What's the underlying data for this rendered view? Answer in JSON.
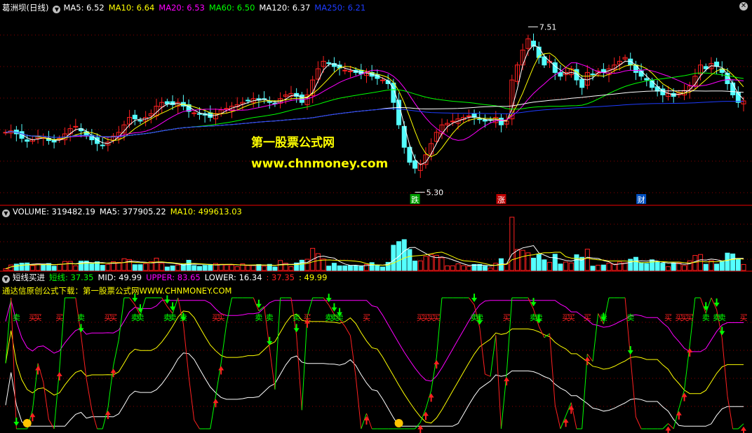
{
  "main_header": {
    "title": "葛洲坝(日线)",
    "ma5": "MA5: 6.52",
    "ma10": "MA10: 6.64",
    "ma20": "MA20: 6.53",
    "ma60": "MA60: 6.50",
    "ma120": "MA120: 6.37",
    "ma250": "MA250: 6.21"
  },
  "volume_header": {
    "volume": "VOLUME: 319482.19",
    "ma5": "MA5: 377905.22",
    "ma10": "MA10: 499613.03"
  },
  "indicator_header": {
    "name": "短线买进",
    "short": "短线: 37.35",
    "mid": "MID: 49.99",
    "upper": "UPPER: 83.65",
    "lower": "LOWER: 16.34",
    "extra1": ": 37.35",
    "extra2": ": 49.99"
  },
  "indicator_note": "通达信原创公式下载：第一股票公式网WWW.CHNMONEY.COM",
  "watermark": {
    "line1": "第一股票公式网",
    "line2": "www.chnmoney.com"
  },
  "colors": {
    "ma5": "#ffffff",
    "ma10": "#ffff00",
    "ma20": "#ff00ff",
    "ma60": "#00ff00",
    "ma120": "#ffffff",
    "ma250": "#1e3cff",
    "up": "#ff2020",
    "down": "#54ffff",
    "grid": "#8b0000"
  },
  "chart_data": [
    {
      "type": "candlestick",
      "title": "葛洲坝(日线)",
      "ylim": [
        5.2,
        7.7
      ],
      "annotations": [
        {
          "label": "7.51",
          "kind": "high"
        },
        {
          "label": "5.30",
          "kind": "low"
        }
      ],
      "event_tags": [
        "跌",
        "涨",
        "财"
      ],
      "series": [
        {
          "name": "MA5",
          "key": "ma5"
        },
        {
          "name": "MA10",
          "key": "ma10"
        },
        {
          "name": "MA20",
          "key": "ma20"
        },
        {
          "name": "MA60",
          "key": "ma60"
        },
        {
          "name": "MA120",
          "key": "ma120"
        },
        {
          "name": "MA250",
          "key": "ma250"
        }
      ],
      "closes": [
        6.1,
        6.12,
        6.08,
        6.02,
        5.98,
        6.0,
        6.05,
        6.03,
        5.99,
        5.97,
        6.02,
        6.08,
        6.15,
        6.18,
        6.12,
        6.05,
        6.0,
        5.95,
        5.93,
        5.97,
        6.05,
        6.1,
        6.2,
        6.3,
        6.28,
        6.25,
        6.3,
        6.35,
        6.45,
        6.5,
        6.48,
        6.47,
        6.5,
        6.45,
        6.38,
        6.36,
        6.34,
        6.33,
        6.3,
        6.35,
        6.4,
        6.42,
        6.45,
        6.47,
        6.5,
        6.52,
        6.55,
        6.53,
        6.54,
        6.5,
        6.48,
        6.55,
        6.6,
        6.62,
        6.58,
        6.5,
        6.6,
        6.8,
        6.95,
        7.05,
        7.02,
        6.98,
        6.96,
        6.93,
        6.92,
        6.9,
        6.88,
        6.9,
        6.85,
        6.82,
        6.8,
        6.75,
        6.5,
        6.2,
        5.9,
        5.7,
        5.62,
        5.68,
        5.8,
        5.95,
        6.1,
        6.2,
        6.22,
        6.25,
        6.28,
        6.3,
        6.32,
        6.3,
        6.27,
        6.25,
        6.26,
        6.3,
        6.2,
        6.25,
        6.8,
        7.0,
        7.2,
        7.35,
        7.25,
        7.1,
        7.0,
        7.05,
        6.9,
        6.85,
        6.9,
        6.95,
        6.8,
        6.7,
        6.9,
        6.88,
        6.92,
        6.9,
        6.95,
        7.0,
        7.05,
        7.1,
        7.0,
        6.9,
        6.85,
        6.8,
        6.7,
        6.65,
        6.6,
        6.62,
        6.58,
        6.63,
        6.66,
        6.72,
        6.85,
        7.0,
        6.95,
        7.02,
        6.98,
        6.9,
        6.75,
        6.6,
        6.5,
        6.52
      ],
      "volume": {
        "title": "VOLUME"
      },
      "indicator": {
        "name": "短线买进",
        "lines": [
          "短线",
          "MID",
          "UPPER",
          "LOWER"
        ],
        "upper_ylim": [
          0,
          100
        ],
        "buy_label": "买",
        "sell_label": "卖"
      }
    }
  ]
}
